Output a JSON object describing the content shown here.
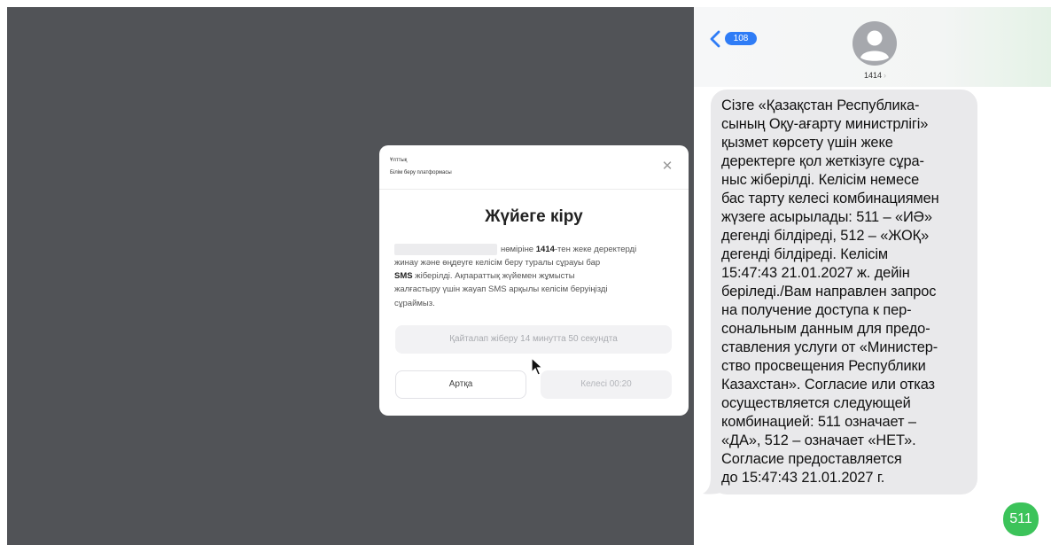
{
  "modal": {
    "brand_line1": "Ұлттық",
    "brand_line2": "Білім беру платформасы",
    "close_icon": "close-icon",
    "title": "Жүйеге кіру",
    "message": {
      "line1_pre": "нөміріне ",
      "line1_bold": "1414",
      "line1_post": "-тен жеке деректерді",
      "line2": "жинау және өңдеуге келісім беру туралы сұрауы бар",
      "line3_bold": "SMS",
      "line3_post": " жіберілді. Ақпараттық жүйемен жұмысты",
      "line4": "жалғастыру үшін жауап SMS арқылы келісім беруіңізді",
      "line5": "сұраймыз."
    },
    "resend_label": "Қайталап жіберу 14 минутта 50 секундта",
    "back_label": "Артқа",
    "next_label": "Келесі 00:20"
  },
  "messages_app": {
    "unread_count": "108",
    "contact_name": "1414",
    "contact_chevron": "›",
    "received_message_lines": [
      "Сізге «Қазақстан Республика-",
      "сының Оқу-ағарту министрлігі»",
      "қызмет көрсету үшін жеке",
      "деректерге қол жеткізуге сұра-",
      "ныс жіберілді. Келісім немесе",
      "бас тарту келесі комбинациямен",
      "жүзеге асырылады: 511 – «ИӘ»",
      "дегенді білдіреді, 512 – «ЖОҚ»",
      "дегенді білдіреді. Келісім",
      "15:47:43 21.01.2027 ж. дейін",
      "беріледі./Вам направлен запрос",
      "на получение доступа к пер-",
      "сональным данным для предо-",
      "ставления услуги от «Министер-",
      "ство просвещения Республики",
      "Казахстан». Согласие или отказ",
      "осуществляется следующей",
      "комбинацией: 511 означает –",
      "«ДА», 512 – означает «НЕТ».",
      "Согласие предоставляется",
      "до 15:47:43 21.01.2027 г."
    ],
    "sent_message": "511"
  },
  "colors": {
    "backdrop": "#515357",
    "received_bubble": "#e9e9eb",
    "sent_bubble": "#3cc35a",
    "badge": "#2f7cf6"
  }
}
